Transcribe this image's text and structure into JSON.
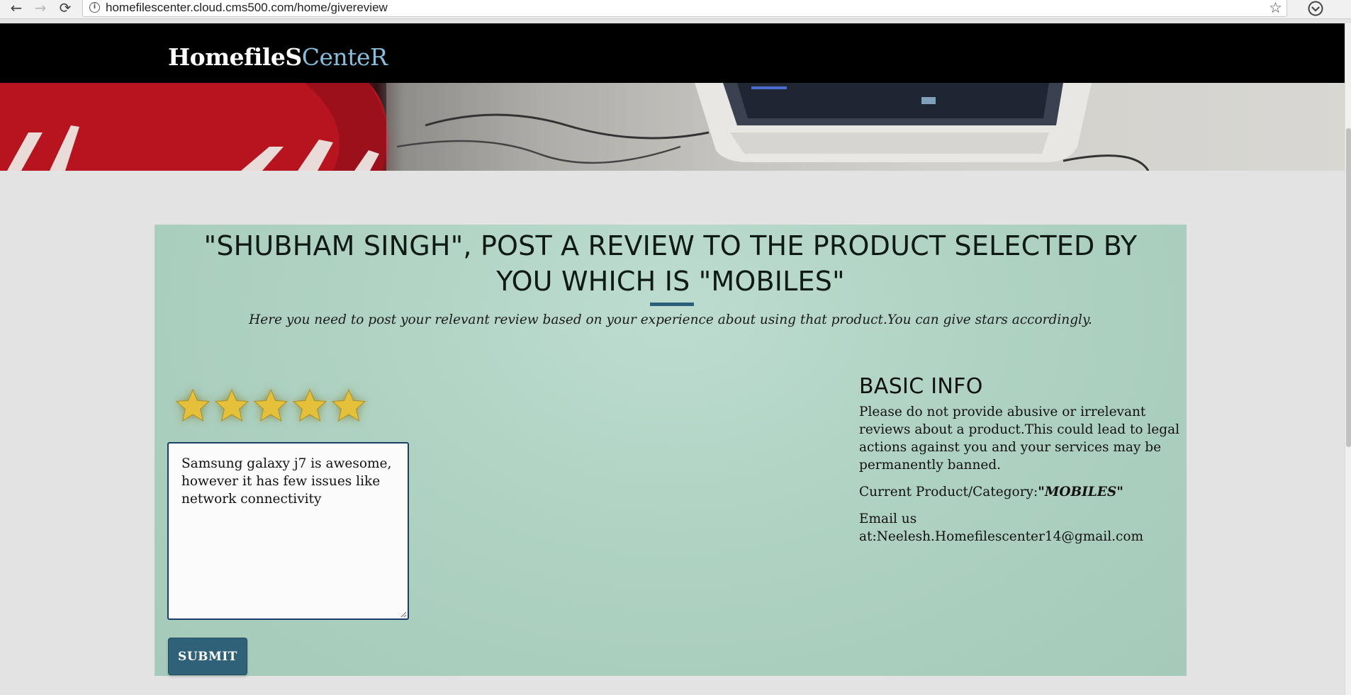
{
  "browser": {
    "url": "homefilescenter.cloud.cms500.com/home/givereview",
    "back_icon": "←",
    "forward_icon": "→",
    "reload_icon": "⟳",
    "info_icon": "i",
    "bookmark_icon": "☆"
  },
  "site": {
    "logo_part1": "HomefileS",
    "logo_part2": "CenteR",
    "logo_accent_color": "#86bfdd"
  },
  "review": {
    "title": "\"SHUBHAM SINGH\", POST A REVIEW TO THE PRODUCT SELECTED BY YOU WHICH IS \"MOBILES\"",
    "subtitle": "Here you need to post your relevant review based on your experience about using that product.You can give stars accordingly.",
    "rating": 5,
    "max_rating": 5,
    "review_text": "Samsung galaxy j7 is awesome, however it has few issues like network connectivity",
    "submit_label": "SUBMIT"
  },
  "basic_info": {
    "heading": "BASIC INFO",
    "notice": "Please do not provide abusive or irrelevant reviews about a product.This could lead to legal actions against you and your services may be permanently banned.",
    "product_label": "Current Product/Category:",
    "product_value": "\"MOBILES\"",
    "email_text": "Email us at:Neelesh.Homefilescenter14@gmail.com"
  },
  "colors": {
    "header_bg": "#000000",
    "panel_bg": "#afd2c2",
    "submit_bg": "#2f6178",
    "star_fill": "#e5c13b",
    "accent_line": "#2c5f7c"
  }
}
